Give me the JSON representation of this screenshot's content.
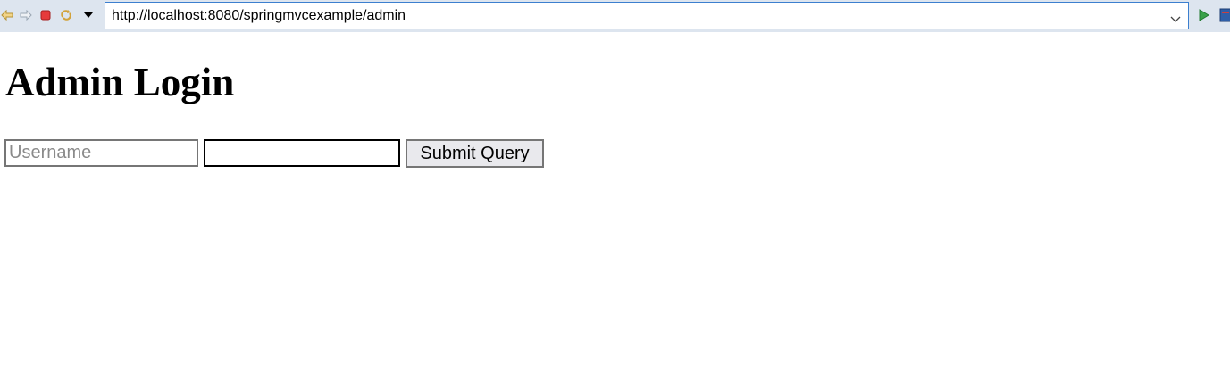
{
  "browser": {
    "toolbar_icons": [
      "back-arrow-icon",
      "forward-arrow-icon",
      "stop-icon",
      "refresh-icon",
      "dropdown-arrow-icon"
    ],
    "url": "http://localhost:8080/springmvcexample/admin",
    "right_icons": [
      "go-arrow-icon",
      "window-icon"
    ],
    "colors": {
      "toolbar_bg": "#dde5ef",
      "url_border": "#3c7fcf",
      "stop_red": "#e63b3b",
      "go_green": "#3aa14a"
    }
  },
  "page": {
    "title": "Admin Login",
    "form": {
      "username_placeholder": "Username",
      "password_value": "",
      "submit_label": "Submit Query"
    }
  }
}
